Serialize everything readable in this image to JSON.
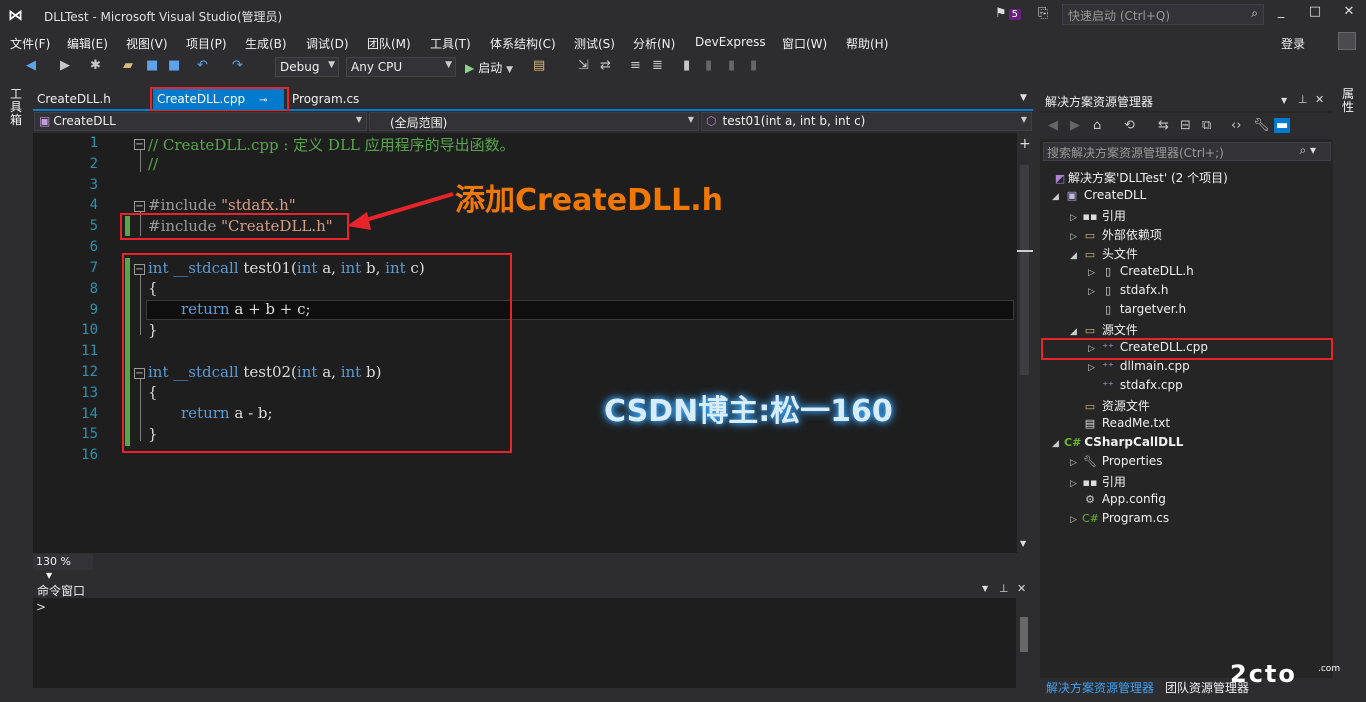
{
  "window": {
    "title": "DLLTest - Microsoft Visual Studio(管理员)",
    "notification_count": "5",
    "quick_launch_placeholder": "快速启动 (Ctrl+Q)",
    "login": "登录"
  },
  "menu": [
    "文件(F)",
    "编辑(E)",
    "视图(V)",
    "项目(P)",
    "生成(B)",
    "调试(D)",
    "团队(M)",
    "工具(T)",
    "体系结构(C)",
    "测试(S)",
    "分析(N)",
    "DevExpress",
    "窗口(W)",
    "帮助(H)"
  ],
  "toolbar": {
    "config": "Debug",
    "platform": "Any CPU",
    "start": "启动"
  },
  "side_labels": {
    "left": "工具箱",
    "right": "属性"
  },
  "tabs": [
    {
      "label": "CreateDLL.h"
    },
    {
      "label": "CreateDLL.cpp"
    },
    {
      "label": "Program.cs"
    }
  ],
  "navbar": {
    "project": "CreateDLL",
    "scope": "(全局范围)",
    "member": "test01(int a, int b, int c)"
  },
  "code": {
    "line_numbers": [
      "1",
      "2",
      "3",
      "4",
      "5",
      "6",
      "7",
      "8",
      "9",
      "10",
      "11",
      "12",
      "13",
      "14",
      "15",
      "16"
    ],
    "l1": "// CreateDLL.cpp : 定义 DLL 应用程序的导出函数。",
    "l2": "//",
    "l4_pp": "#include",
    "l4_str": "\"stdafx.h\"",
    "l5_pp": "#include",
    "l5_str": "\"CreateDLL.h\"",
    "kw_int": "int",
    "stdcall": "__stdcall",
    "l7_fn": "test01(",
    "l7_rest_a": "a,",
    "l7_rest_b": "b,",
    "l7_rest_c": "c)",
    "open_brace": "{",
    "close_brace": "}",
    "kw_return": "return",
    "l9_expr": "a + b + c;",
    "l12_fn": "test02(",
    "l12_rest_a": "a,",
    "l12_rest_b": "b)",
    "l14_expr": "a - b;"
  },
  "annotation": "添加CreateDLL.h",
  "watermark": "CSDN博主:松一160",
  "zoom": "130 %",
  "command_window": {
    "title": "命令窗口",
    "prompt": ">"
  },
  "solution_explorer": {
    "title": "解决方案资源管理器",
    "search_placeholder": "搜索解决方案资源管理器(Ctrl+;)",
    "tree": [
      {
        "label": "解决方案'DLLTest' (2 个项目)",
        "icon": "solution-icon"
      },
      {
        "label": "CreateDLL",
        "icon": "cpp-project-icon"
      },
      {
        "label": "引用",
        "icon": "references-icon"
      },
      {
        "label": "外部依赖项",
        "icon": "folder-icon"
      },
      {
        "label": "头文件",
        "icon": "folder-icon"
      },
      {
        "label": "CreateDLL.h",
        "icon": "header-file-icon"
      },
      {
        "label": "stdafx.h",
        "icon": "header-file-icon"
      },
      {
        "label": "targetver.h",
        "icon": "header-file-icon"
      },
      {
        "label": "源文件",
        "icon": "folder-icon"
      },
      {
        "label": "CreateDLL.cpp",
        "icon": "cpp-file-icon"
      },
      {
        "label": "dllmain.cpp",
        "icon": "cpp-file-icon"
      },
      {
        "label": "stdafx.cpp",
        "icon": "cpp-file-icon"
      },
      {
        "label": "资源文件",
        "icon": "folder-icon"
      },
      {
        "label": "ReadMe.txt",
        "icon": "text-file-icon"
      },
      {
        "label": "CSharpCallDLL",
        "icon": "csharp-project-icon"
      },
      {
        "label": "Properties",
        "icon": "wrench-icon"
      },
      {
        "label": "引用",
        "icon": "references-icon"
      },
      {
        "label": "App.config",
        "icon": "config-file-icon"
      },
      {
        "label": "Program.cs",
        "icon": "csharp-file-icon"
      }
    ],
    "bottom_tabs": [
      "解决方案资源管理器",
      "团队资源管理器"
    ]
  },
  "corner_logo": "2cto",
  "corner_logo_sub": ".com"
}
